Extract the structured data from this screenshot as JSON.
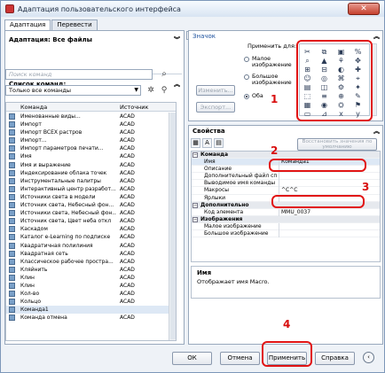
{
  "window": {
    "title": "Адаптация пользовательского интерфейса",
    "close_label": "✕"
  },
  "tabs": [
    {
      "label": "Адаптация"
    },
    {
      "label": "Перевести"
    }
  ],
  "left": {
    "adaptations_header": "Адаптация: Все файлы",
    "commands_header": "Список команд:",
    "search_placeholder": "Поиск команд",
    "filter_value": "Только все команды",
    "columns": {
      "name": "Команда",
      "source": "Источник"
    },
    "rows": [
      {
        "name": "Именованные виды...",
        "source": "ACAD"
      },
      {
        "name": "Импорт",
        "source": "ACAD"
      },
      {
        "name": "Импорт ВСЕХ растров",
        "source": "ACAD"
      },
      {
        "name": "Импорт...",
        "source": "ACAD"
      },
      {
        "name": "Импорт параметров печати...",
        "source": "ACAD"
      },
      {
        "name": "Имя",
        "source": "ACAD"
      },
      {
        "name": "Имя и выражение",
        "source": "ACAD"
      },
      {
        "name": "Индексирование облака точек",
        "source": "ACAD"
      },
      {
        "name": "Инструментальные палитры",
        "source": "ACAD"
      },
      {
        "name": "Интерактивный центр разработ...",
        "source": "ACAD"
      },
      {
        "name": "Источники света в модели",
        "source": "ACAD"
      },
      {
        "name": "Источник света, Небесный фон...",
        "source": "ACAD"
      },
      {
        "name": "Источники света, Небесный фон...",
        "source": "ACAD"
      },
      {
        "name": "Источник света, Цвет неба откл",
        "source": "ACAD"
      },
      {
        "name": "Каскадом",
        "source": "ACAD"
      },
      {
        "name": "Каталог e-Learning по подписке",
        "source": "ACAD"
      },
      {
        "name": "Квадратичная полилиния",
        "source": "ACAD"
      },
      {
        "name": "Квадратная сеть",
        "source": "ACAD"
      },
      {
        "name": "Классическое рабочее простра...",
        "source": "ACAD"
      },
      {
        "name": "Кляйнить",
        "source": "ACAD"
      },
      {
        "name": "Клин",
        "source": "ACAD"
      },
      {
        "name": "Клин",
        "source": "ACAD"
      },
      {
        "name": "Кол-во",
        "source": "ACAD"
      },
      {
        "name": "Кольцо",
        "source": "ACAD"
      },
      {
        "name": "Команда1",
        "source": ""
      },
      {
        "name": "Команда отмена",
        "source": "ACAD"
      }
    ]
  },
  "icon_panel": {
    "title": "Значок",
    "apply_to": "Применить для:",
    "options": [
      "Малое изображение",
      "Большое изображение",
      "Оба"
    ],
    "selected": "Оба",
    "edit_button": "Изменить...",
    "export_button": "Экспорт...",
    "icons": [
      "✂",
      "⧉",
      "▣",
      "%",
      "⌕",
      "▲",
      "⚘",
      "✥",
      "⊞",
      "⊟",
      "◐",
      "✚",
      "☺",
      "◎",
      "⌘",
      "⌖",
      "▤",
      "◫",
      "⚙",
      "✦",
      "⬚",
      "≡",
      "⊕",
      "✎",
      "▦",
      "◉",
      "⛭",
      "⚑",
      "▭",
      "⊿",
      "x",
      "y"
    ]
  },
  "props_panel": {
    "title": "Свойства",
    "restore_button": "Восстановить значения по умолчанию",
    "rows": [
      {
        "type": "cat",
        "key": "Команда",
        "value": ""
      },
      {
        "type": "prop",
        "key": "Имя",
        "value": "Команда1"
      },
      {
        "type": "prop",
        "key": "Описание",
        "value": ""
      },
      {
        "type": "prop",
        "key": "Дополнительный файл сп",
        "value": ""
      },
      {
        "type": "prop",
        "key": "Выводимое имя команды",
        "value": ""
      },
      {
        "type": "prop",
        "key": "Макросы",
        "value": "^C^C"
      },
      {
        "type": "prop",
        "key": "Ярлыки",
        "value": ""
      },
      {
        "type": "cat",
        "key": "Дополнительно",
        "value": ""
      },
      {
        "type": "prop",
        "key": "Код элемента",
        "value": "MMU_0037"
      },
      {
        "type": "cat",
        "key": "Изображения",
        "value": ""
      },
      {
        "type": "prop",
        "key": "Малое изображение",
        "value": ""
      },
      {
        "type": "prop",
        "key": "Большое изображение",
        "value": ""
      }
    ],
    "desc_title": "Имя",
    "desc_text": "Отображает имя Macro."
  },
  "annotations": [
    "1",
    "2",
    "3",
    "4"
  ],
  "buttons": {
    "ok": "ОК",
    "cancel": "Отмена",
    "apply": "Применить",
    "help": "Справка",
    "nav": "‹"
  },
  "colors": {
    "highlight": "#e11414",
    "accent": "#1a4f9c"
  }
}
